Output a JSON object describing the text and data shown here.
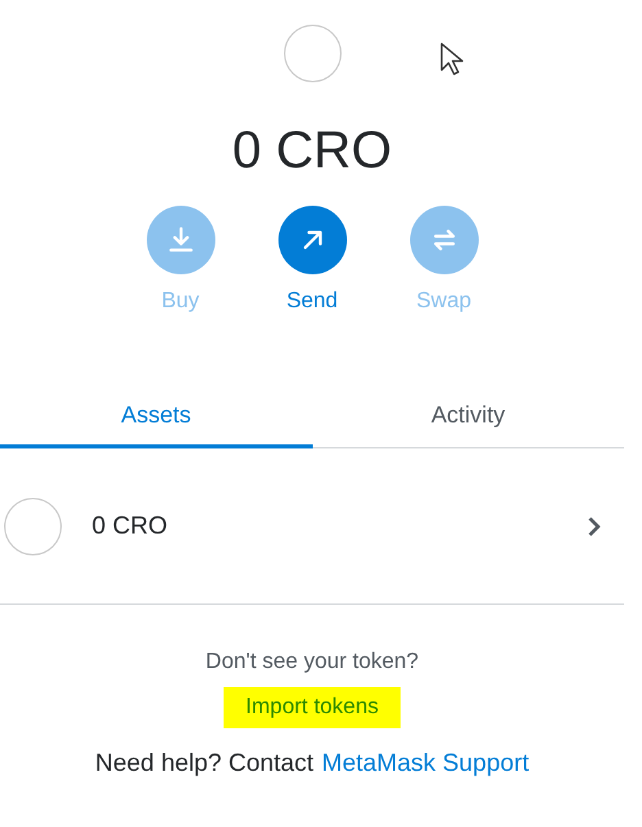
{
  "balance": "0 CRO",
  "actions": [
    {
      "kind": "buy",
      "label": "Buy",
      "disabled": true
    },
    {
      "kind": "send",
      "label": "Send",
      "disabled": false
    },
    {
      "kind": "swap",
      "label": "Swap",
      "disabled": true
    }
  ],
  "tabs": [
    {
      "label": "Assets",
      "selected": true
    },
    {
      "label": "Activity",
      "selected": false
    }
  ],
  "assets": [
    {
      "amount": "0 CRO"
    }
  ],
  "footer": {
    "prompt": "Don't see your token?",
    "import_link": "Import tokens",
    "import_highlighted": true,
    "help_text": "Need help? Contact",
    "support_link": "MetaMask Support"
  }
}
